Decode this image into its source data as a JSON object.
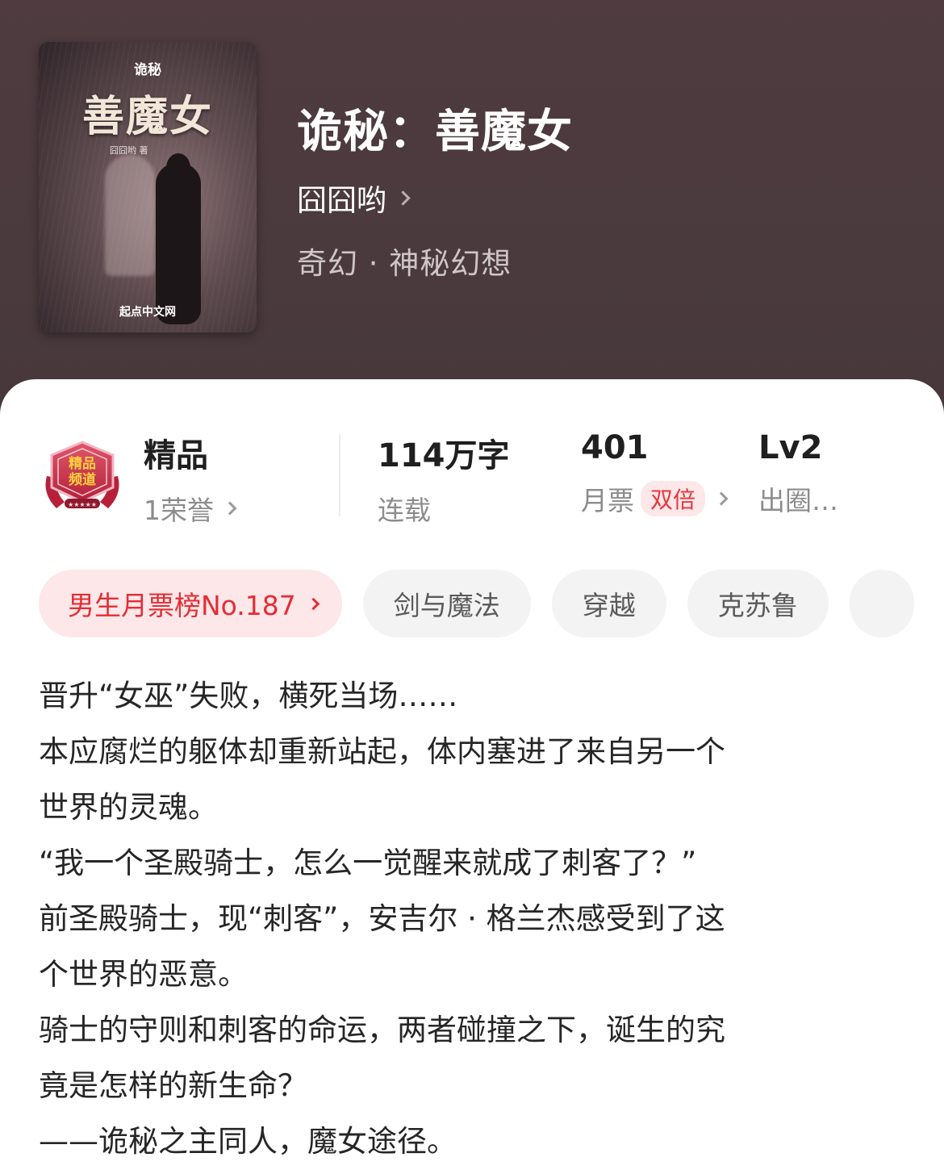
{
  "book": {
    "cover": {
      "series": "诡秘",
      "title": "善魔女",
      "author": "囧囧哟 著",
      "publisher": "起点中文网"
    },
    "title": "诡秘：善魔女",
    "author": "囧囧哟",
    "genre": "奇幻 · 神秘幻想"
  },
  "stats": {
    "badge_label": "精品",
    "badge_icon_text": "精品频道",
    "honor": "1荣誉",
    "word_count": "114万字",
    "status": "连载",
    "monthly_votes": "401",
    "monthly_votes_label": "月票",
    "double_label": "双倍",
    "level": "Lv2",
    "level_label": "出圈…"
  },
  "tags": {
    "rank": "男生月票榜No.187",
    "items": [
      "剑与魔法",
      "穿越",
      "克苏鲁"
    ]
  },
  "synopsis": [
    "晋升“女巫”失败，横死当场……",
    "本应腐烂的躯体却重新站起，体内塞进了来自另一个",
    "世界的灵魂。",
    "“我一个圣殿骑士，怎么一觉醒来就成了刺客了？”",
    "前圣殿骑士，现“刺客”，安吉尔 · 格兰杰感受到了这",
    "个世界的恶意。",
    "骑士的守则和刺客的命运，两者碰撞之下，诞生的究",
    "竟是怎样的新生命？",
    "——诡秘之主同人，魔女途径。"
  ],
  "colors": {
    "header_bg": "#4f3b40",
    "accent_red": "#e42d35",
    "tag_bg": "#f3f3f3"
  }
}
